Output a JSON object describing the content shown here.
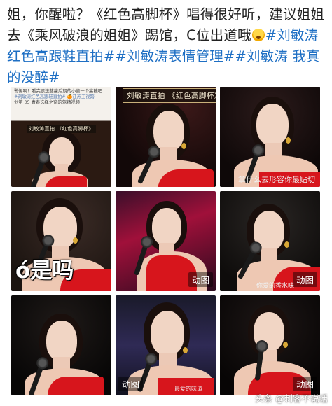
{
  "post": {
    "text_part1": "姐，你醒啦？《红色高脚杯》唱得很好听，建议姐姐去《乘风破浪的姐姐》踢馆，C位出道哦",
    "emoji": "scared-face-emoji",
    "tag1": "#刘敏涛红色高跟鞋直拍#",
    "tag2": "#刘敏涛表情管理#",
    "tag3": "#刘敏涛 我真的没醉#"
  },
  "tiles": [
    {
      "line1": "警惕啊！看完该选慈瘦后期的小偏一个高穗吧",
      "line2": "#刘敏涛红色高跟鞋直拍# 🍊江苏卫视跨",
      "line3": "划第 05 青春选择之窗的驾精视频",
      "caption": "刘敏涛直拍 《红色高脚杯》"
    },
    {
      "caption": "刘敏涛直拍 《红色高脚杯》"
    },
    {
      "subtitle": "拿什么去形容你最贴切"
    },
    {
      "big_text": "ó是吗"
    },
    {
      "badge": "动图"
    },
    {
      "badge": "动图",
      "small_text": "你爱的香水味"
    },
    {
      "badge": ""
    },
    {
      "badge": "动图",
      "small_text": "最爱的味道"
    },
    {
      "badge": "动图"
    }
  ],
  "watermark": "头条 @刺客不说话",
  "colors": {
    "tag": "#1e6fc4",
    "dress": "#d7151c"
  }
}
